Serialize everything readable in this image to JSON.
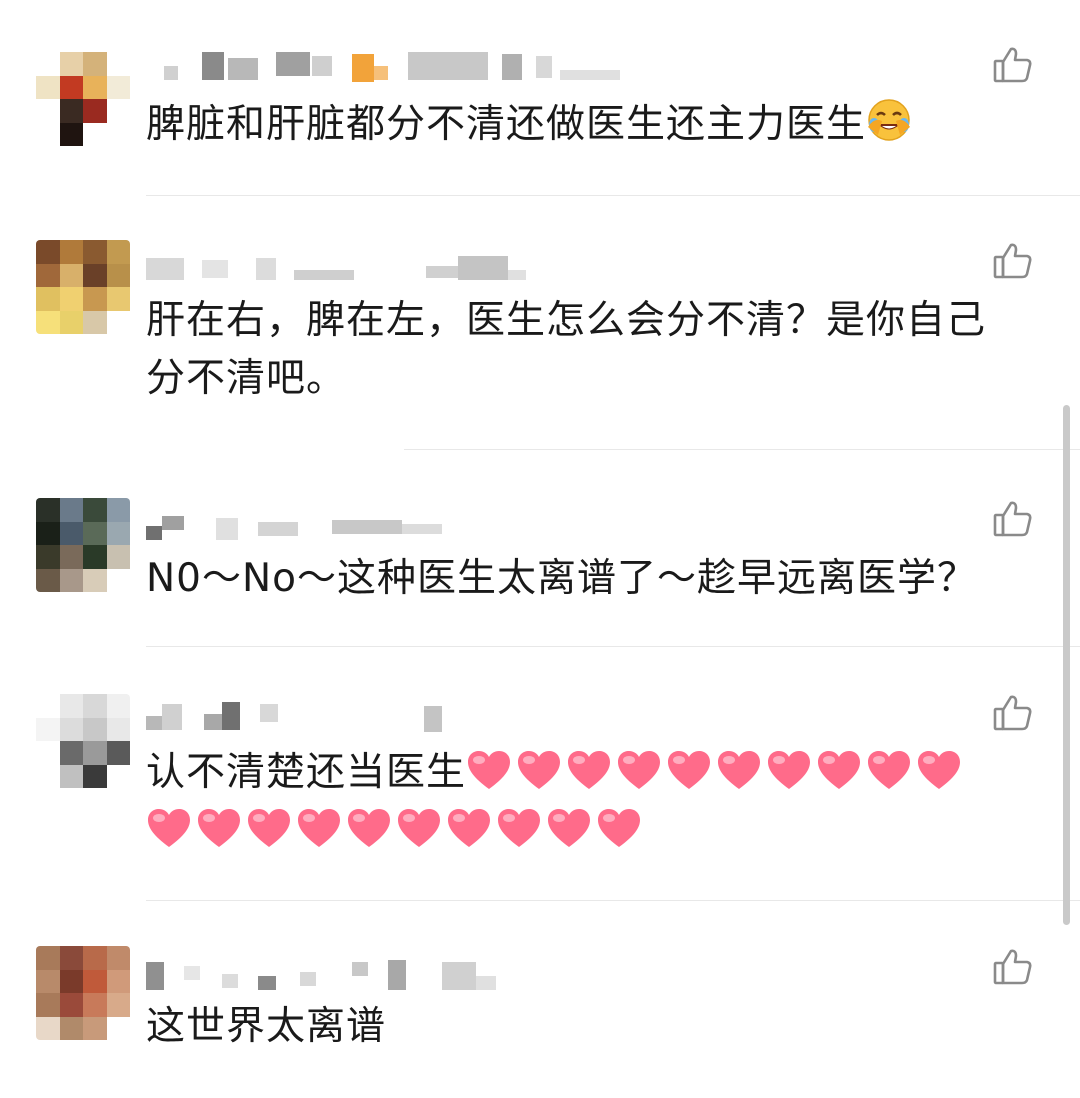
{
  "comments": [
    {
      "text": "脾脏和肝脏都分不清还做医生还主力医生",
      "emoji": "face-with-tears-of-joy-icon",
      "avatar_colors": [
        "#ffffff",
        "#e7d0a8",
        "#d4b27a",
        "#ffffff",
        "#efe3c4",
        "#c23a22",
        "#e8b25a",
        "#f2ebd8",
        "#ffffff",
        "#3a2a22",
        "#9a2a20",
        "#ffffff",
        "#ffffff",
        "#1f1410",
        "#ffffff",
        "#ffffff"
      ]
    },
    {
      "text": "肝在右，脾在左，医生怎么会分不清？是你自己分不清吧。",
      "avatar_colors": [
        "#7a4a2a",
        "#b07a3a",
        "#8a5a30",
        "#c29a50",
        "#a0683a",
        "#d8b06a",
        "#6a4028",
        "#b8904a",
        "#e0c060",
        "#f0d070",
        "#c89850",
        "#e8c870",
        "#f6e07a",
        "#e8d06a",
        "#d8c8a8",
        "#ffffff"
      ]
    },
    {
      "text": "N0～No～这种医生太离谱了～趁早远离医学？",
      "avatar_colors": [
        "#2a3028",
        "#6a7a8a",
        "#3a4a3a",
        "#8a9aa8",
        "#1a2018",
        "#4a5a6a",
        "#5a6a58",
        "#9aa8b0",
        "#3a3a2a",
        "#7a6a5a",
        "#2a3a28",
        "#c8c0b0",
        "#6a5a48",
        "#a8988a",
        "#d8ccb8",
        "#ffffff"
      ]
    },
    {
      "text": "认不清楚还当医生",
      "heart_count": 20,
      "heart_color": "#ff6b8a",
      "avatar_colors": [
        "#ffffff",
        "#e8e8e8",
        "#d8d8d8",
        "#f0f0f0",
        "#f4f4f4",
        "#dcdcdc",
        "#c8c8c8",
        "#e8e8e8",
        "#ffffff",
        "#6a6a6a",
        "#9a9a9a",
        "#5a5a5a",
        "#ffffff",
        "#c0c0c0",
        "#3a3a3a",
        "#ffffff"
      ]
    },
    {
      "text": "这世界太离谱",
      "avatar_colors": [
        "#a87a5a",
        "#8a4a3a",
        "#b86a4a",
        "#c08a6a",
        "#b88a6a",
        "#7a3a2a",
        "#c05a3a",
        "#d09a7a",
        "#a87a5a",
        "#9a4a3a",
        "#c87a5a",
        "#d8aa8a",
        "#e8d8c8",
        "#b08a6a",
        "#c89a7a",
        "#ffffff"
      ]
    }
  ],
  "colors": {
    "text": "#1a1a1a",
    "divider": "#e8e8e8",
    "icon": "#8a8a8a",
    "scrollbar": "#c9c9c9"
  }
}
